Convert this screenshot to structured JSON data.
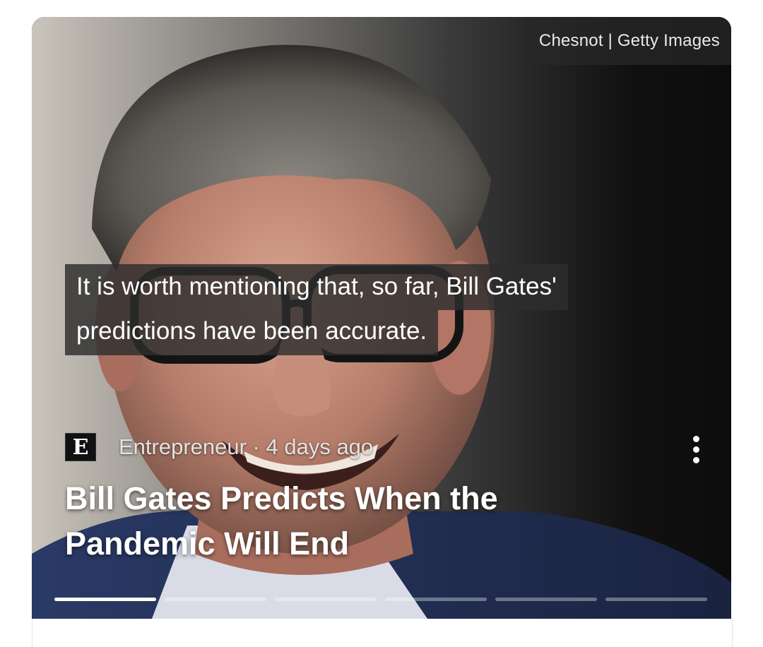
{
  "card": {
    "image": {
      "credit": "Chesnot | Getty Images"
    },
    "quote": {
      "line1": "It is worth mentioning that, so far, Bill Gates'",
      "line2": "predictions have been accurate."
    },
    "source": {
      "logo_letter": "E",
      "meta": "Entrepreneur · 4 days ago"
    },
    "headline": {
      "line1": "Bill Gates Predicts When the",
      "line2": "Pandemic Will End"
    },
    "more_icon": "more-vert-icon",
    "progress": {
      "total_segments": 6,
      "active_index": 0
    }
  },
  "colors": {
    "background": "#ffffff",
    "overlay": "#2d2d2d",
    "text": "#ffffff",
    "progress_inactive": "#8c8c8c",
    "progress_active": "#ffffff"
  }
}
